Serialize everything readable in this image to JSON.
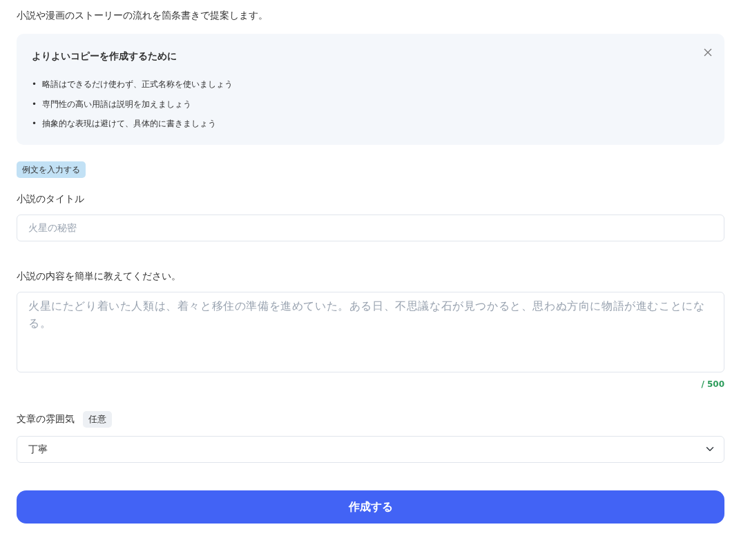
{
  "description": "小説や漫画のストーリーの流れを箇条書きで提案します。",
  "tips": {
    "bullet": "•",
    "title": "よりよいコピーを作成するために",
    "items": [
      "略語はできるだけ使わず、正式名称を使いましょう",
      "専門性の高い用語は説明を加えましょう",
      "抽象的な表現は避けて、具体的に書きましょう"
    ]
  },
  "example_button": "例文を入力する",
  "fields": [
    {
      "kind": "input",
      "label": "小説のタイトル",
      "placeholder": "火星の秘密"
    },
    {
      "kind": "textarea",
      "label": "小説の内容を簡単に教えてください。",
      "placeholder": "火星にたどり着いた人類は、着々と移住の準備を進めていた。ある日、不思議な石が見つかると、思わぬ方向に物語が進むことになる。",
      "counter": "/ 500"
    },
    {
      "kind": "select",
      "label": "文章の雰囲気",
      "badge": "任意",
      "value": "丁寧"
    }
  ],
  "submit": "作成する"
}
